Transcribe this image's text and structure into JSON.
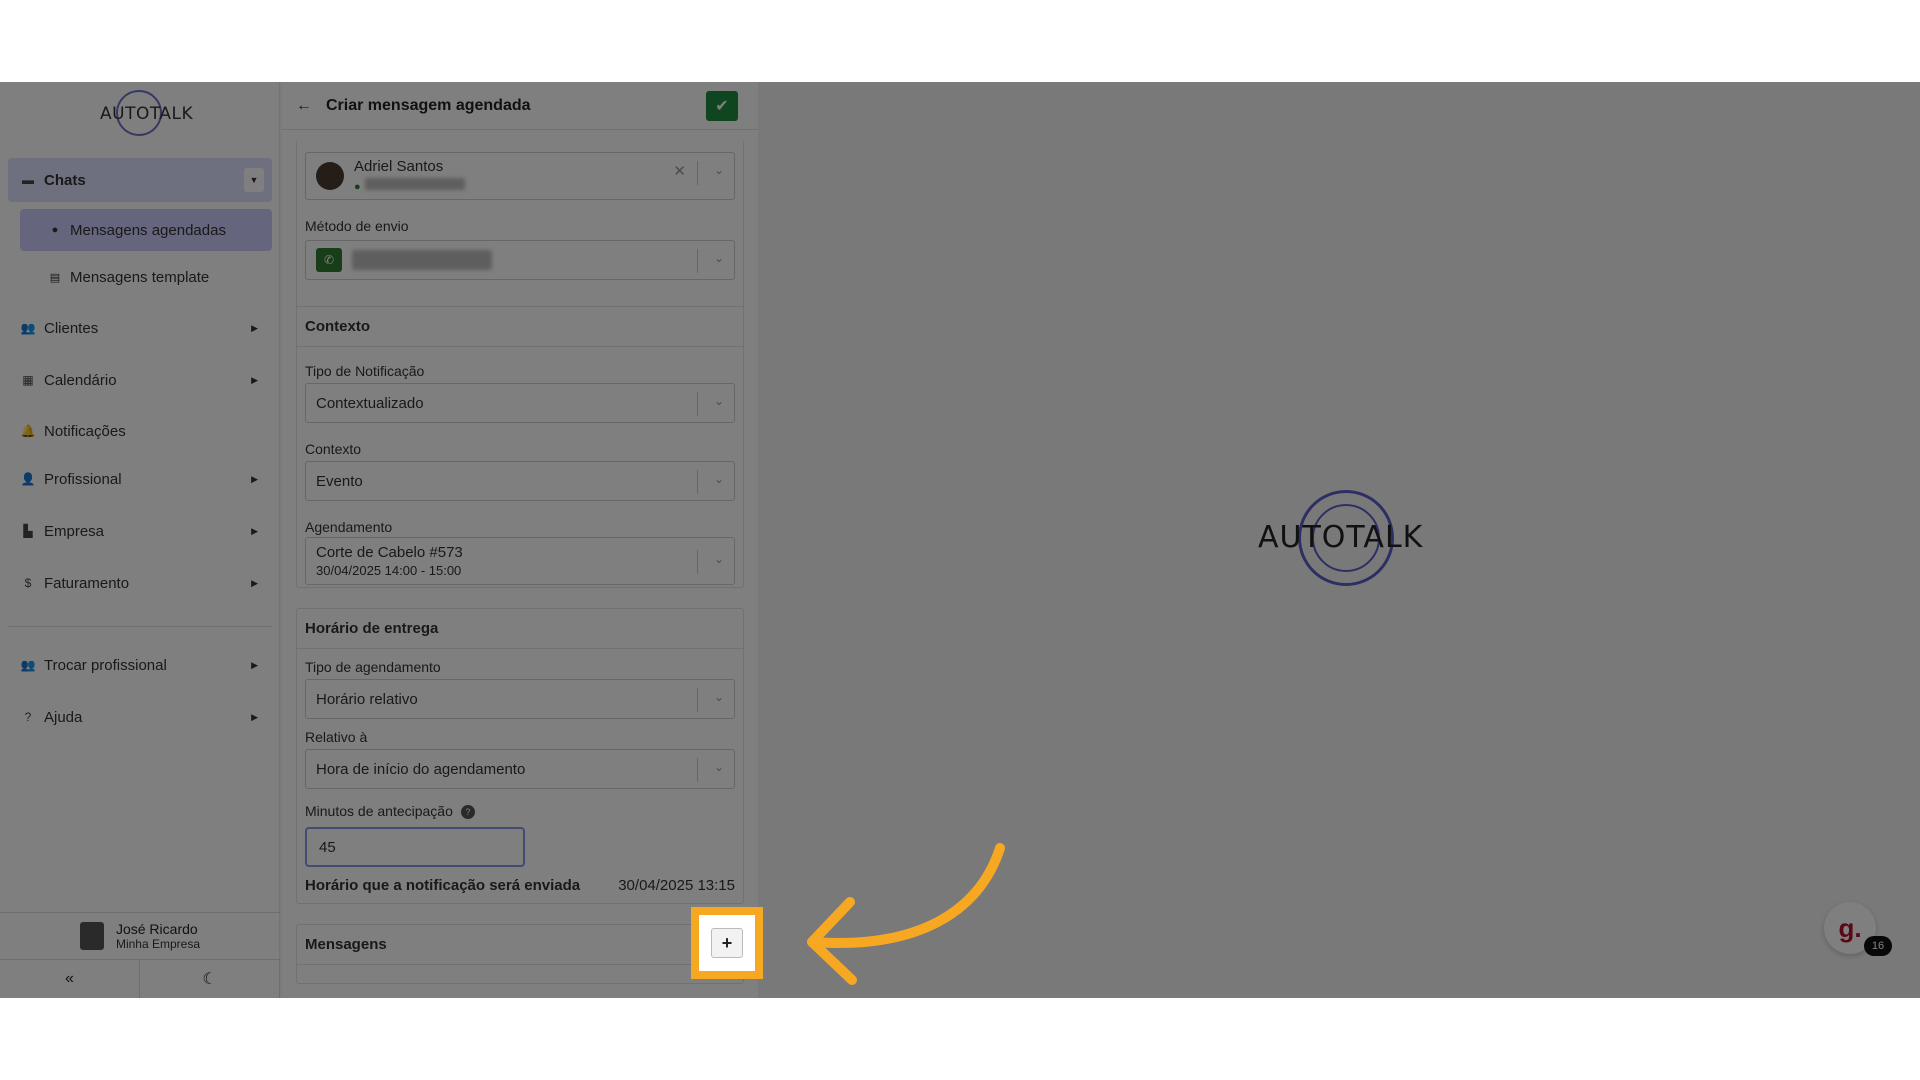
{
  "sidebar": {
    "logo_text": "AUTOTALK",
    "items": [
      {
        "label": "Chats",
        "icon": "chat-icon"
      },
      {
        "label": "Clientes",
        "icon": "users-icon"
      },
      {
        "label": "Calendário",
        "icon": "calendar-icon"
      },
      {
        "label": "Notificações",
        "icon": "bell-icon"
      },
      {
        "label": "Profissional",
        "icon": "user-gear-icon"
      },
      {
        "label": "Empresa",
        "icon": "building-icon"
      },
      {
        "label": "Faturamento",
        "icon": "dollar-icon"
      },
      {
        "label": "Trocar profissional",
        "icon": "users-swap-icon"
      },
      {
        "label": "Ajuda",
        "icon": "help-circle-icon"
      }
    ],
    "sub_items": [
      {
        "label": "Mensagens agendadas",
        "icon": "clock-icon"
      },
      {
        "label": "Mensagens template",
        "icon": "list-icon"
      }
    ],
    "user": {
      "name": "José Ricardo",
      "company": "Minha Empresa"
    }
  },
  "panel": {
    "title": "Criar mensagem agendada",
    "contact": {
      "name": "Adriel Santos"
    },
    "send_method_label": "Método de envio",
    "context_section": "Contexto",
    "notification_type_label": "Tipo de Notificação",
    "notification_type_value": "Contextualizado",
    "context_label": "Contexto",
    "context_value": "Evento",
    "appointment_label": "Agendamento",
    "appointment_title": "Corte de Cabelo #573",
    "appointment_time": "30/04/2025 14:00 - 15:00",
    "delivery_section": "Horário de entrega",
    "schedule_type_label": "Tipo de agendamento",
    "schedule_type_value": "Horário relativo",
    "relative_to_label": "Relativo à",
    "relative_to_value": "Hora de início do agendamento",
    "minutes_label": "Minutos de antecipação",
    "minutes_value": "45",
    "send_time_label": "Horário que a notificação será enviada",
    "send_time_value": "30/04/2025 13:15",
    "messages_section": "Mensagens",
    "add_button": "+"
  },
  "content": {
    "logo_text": "AUTOTALK",
    "chat_widget_letter": "g.",
    "chat_badge_count": "16"
  },
  "colors": {
    "accent": "#cbccfb",
    "save": "#1f8a3e",
    "highlight": "#f7a823"
  }
}
